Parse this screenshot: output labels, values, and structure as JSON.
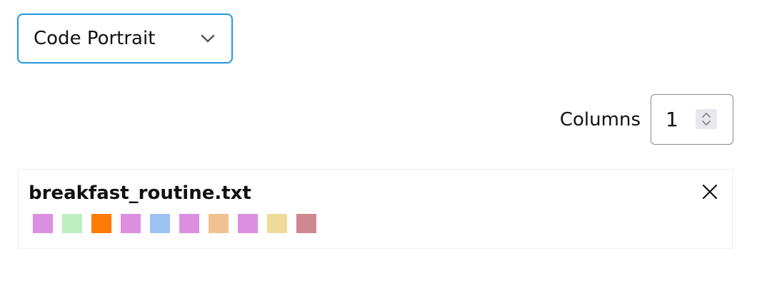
{
  "select": {
    "value": "Code Portrait",
    "icon": "chevron-down-icon"
  },
  "columns": {
    "label": "Columns",
    "value": "1",
    "icon": "stepper-icon"
  },
  "card": {
    "title": "breakfast_routine.txt",
    "close_icon": "close-icon",
    "swatches": [
      "#dc8fe0",
      "#bdeec0",
      "#ff7b06",
      "#dc8fe0",
      "#9cc3f1",
      "#dc8fe0",
      "#efc28f",
      "#dc8fe0",
      "#eedb9a",
      "#cf8890"
    ]
  }
}
